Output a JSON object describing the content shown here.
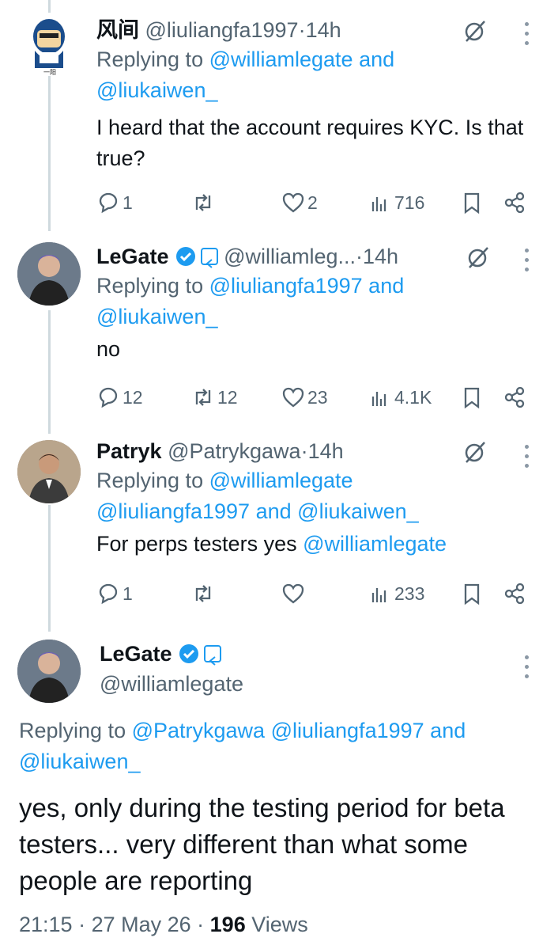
{
  "tweets": [
    {
      "name": "风间",
      "handle": "@liuliangfa1997",
      "time": "14h",
      "replying_prefix": "Replying to ",
      "mentions": [
        "@williamlegate",
        "and",
        "@liukaiwen_"
      ],
      "text": "I heard that the account requires KYC. Is that true?",
      "replies": "1",
      "reposts": "",
      "likes": "2",
      "views": "716"
    },
    {
      "name": "LeGate",
      "handle": "@williamleg...",
      "time": "14h",
      "replying_prefix": "Replying to ",
      "mentions": [
        "@liuliangfa1997",
        "and",
        "@liukaiwen_"
      ],
      "text": "no",
      "replies": "12",
      "reposts": "12",
      "likes": "23",
      "views": "4.1K"
    },
    {
      "name": "Patryk",
      "handle": "@Patrykgawa",
      "time": "14h",
      "replying_prefix": "Replying to ",
      "mentions": [
        "@williamlegate",
        "@liuliangfa1997",
        "and",
        "@liukaiwen_"
      ],
      "text": "For perps testers yes ",
      "text_mention": "@williamlegate",
      "replies": "1",
      "reposts": "",
      "likes": "",
      "views": "233"
    }
  ],
  "main": {
    "name": "LeGate",
    "handle": "@williamlegate",
    "replying_prefix": "Replying to ",
    "mentions": [
      "@Patrykgawa",
      "@liuliangfa1997",
      "and",
      "@liukaiwen_"
    ],
    "text": "yes, only during the testing period for beta testers... very different than what some people are reporting",
    "time": "21:15",
    "date": "27 May 26",
    "views_count": "196",
    "views_label": " Views"
  },
  "sep": " · ",
  "colors": {
    "accent": "#1d9bf0",
    "muted": "#536471",
    "line": "#cfd9de"
  }
}
